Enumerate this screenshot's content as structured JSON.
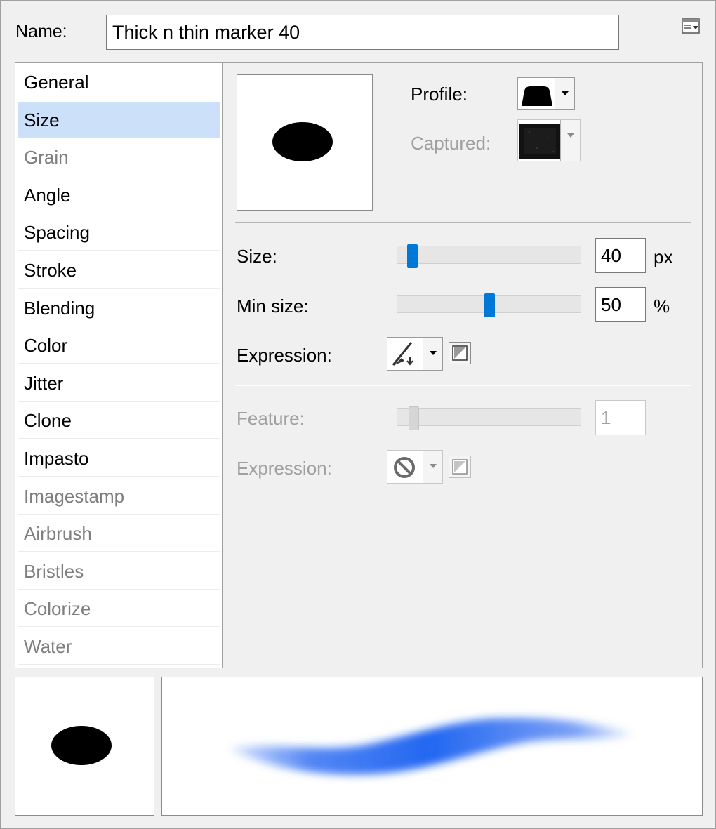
{
  "name_label": "Name:",
  "name_value": "Thick n thin marker 40",
  "categories": [
    {
      "label": "General",
      "state": "enabled"
    },
    {
      "label": "Size",
      "state": "selected"
    },
    {
      "label": "Grain",
      "state": "disabled"
    },
    {
      "label": "Angle",
      "state": "enabled"
    },
    {
      "label": "Spacing",
      "state": "enabled"
    },
    {
      "label": "Stroke",
      "state": "enabled"
    },
    {
      "label": "Blending",
      "state": "enabled"
    },
    {
      "label": "Color",
      "state": "enabled"
    },
    {
      "label": "Jitter",
      "state": "enabled"
    },
    {
      "label": "Clone",
      "state": "enabled"
    },
    {
      "label": "Impasto",
      "state": "enabled"
    },
    {
      "label": "Imagestamp",
      "state": "disabled"
    },
    {
      "label": "Airbrush",
      "state": "disabled"
    },
    {
      "label": "Bristles",
      "state": "disabled"
    },
    {
      "label": "Colorize",
      "state": "disabled"
    },
    {
      "label": "Water",
      "state": "disabled"
    }
  ],
  "size_panel": {
    "profile_label": "Profile:",
    "captured_label": "Captured:",
    "size_label": "Size:",
    "size_value": "40",
    "size_unit": "px",
    "size_slider_fraction": 0.06,
    "min_size_label": "Min size:",
    "min_size_value": "50",
    "min_size_unit": "%",
    "min_size_slider_fraction": 0.5,
    "expression_label": "Expression:",
    "expression_icon": "pen-pressure-icon",
    "feature_label": "Feature:",
    "feature_value": "1",
    "feature_slider_fraction": 0.07,
    "feature_expression_label": "Expression:",
    "feature_expression_icon": "none-circle-icon"
  },
  "icons": {
    "menu": "panel-menu-icon",
    "profile": "profile-shape-icon",
    "captured": "captured-texture-icon",
    "invert": "invert-toggle-icon"
  },
  "colors": {
    "selection": "#cce0fa",
    "slider_thumb": "#0078d7",
    "stroke": "#1a5ff0"
  }
}
